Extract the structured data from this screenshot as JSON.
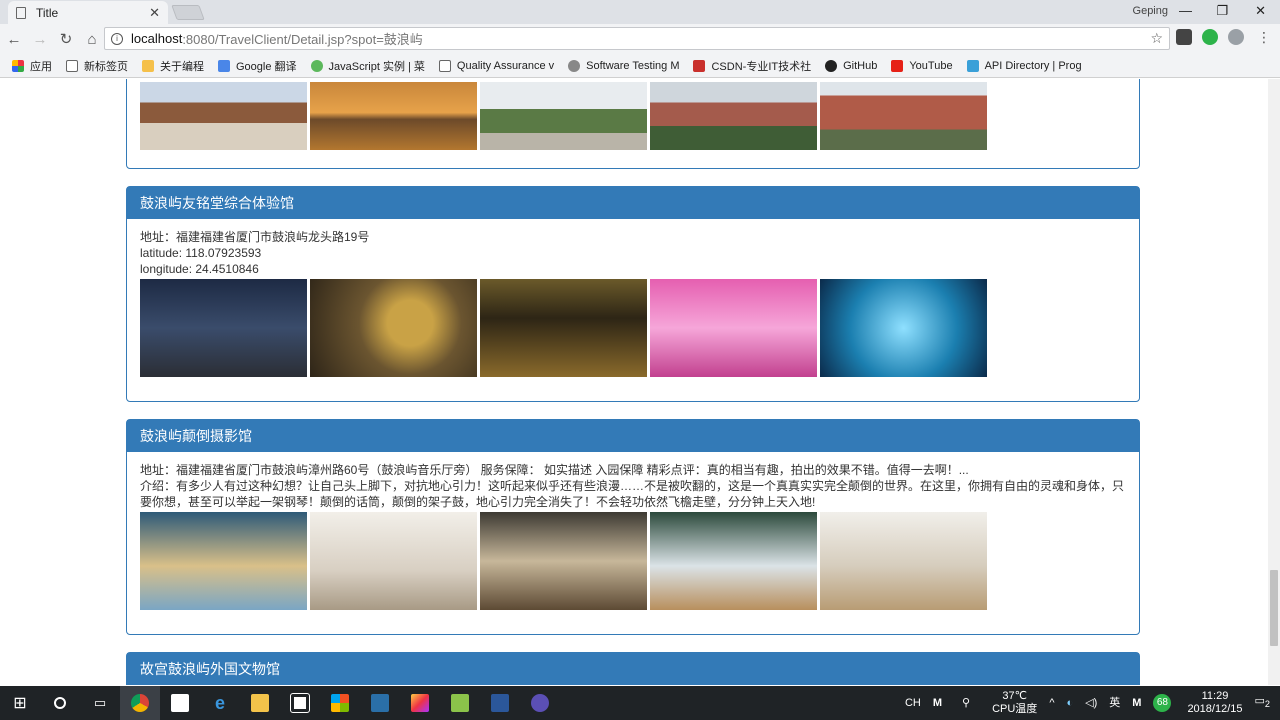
{
  "browser": {
    "tab_title": "Title",
    "user_name": "Geping",
    "url_host": "localhost",
    "url_path": ":8080/TravelClient/Detail.jsp?spot=鼓浪屿",
    "bookmarks": [
      "应用",
      "新标签页",
      "关于编程",
      "Google 翻译",
      "JavaScript 实例 | 菜",
      "Quality Assurance v",
      "Software Testing M",
      "CSDN-专业IT技术社",
      "GitHub",
      "YouTube",
      "API Directory | Prog"
    ]
  },
  "panels": [
    {
      "title": "鼓浪屿友铭堂综合体验馆",
      "lines": [
        "地址：福建福建省厦门市鼓浪屿龙头路19号",
        "latitude: 118.07923593",
        "longitude: 24.4510846"
      ]
    },
    {
      "title": "鼓浪屿颠倒摄影馆",
      "lines": [
        "地址：福建福建省厦门市鼓浪屿漳州路60号（鼓浪屿音乐厅旁） 服务保障： 如实描述 入园保障 精彩点评：真的相当有趣，拍出的效果不错。值得一去啊！...",
        "介绍：有多少人有过这种幻想？让自己头上脚下，对抗地心引力！这听起来似乎还有些浪漫……不是被吹翻的，这是一个真真实实完全颠倒的世界。在这里，你拥有自由的灵魂和身体，只要你想，甚至可以举起一架钢琴！颠倒的话筒，颠倒的架子鼓，地心引力完全消失了！不会轻功依然飞檐走壁，分分钟上天入地!"
      ]
    },
    {
      "title": "故宫鼓浪屿外国文物馆"
    }
  ],
  "taskbar": {
    "ime": "CH",
    "temp": "37℃",
    "temp_label": "CPU温度",
    "lang": "英",
    "badge": "68",
    "time": "11:29",
    "date": "2018/12/15",
    "notify": "2"
  }
}
